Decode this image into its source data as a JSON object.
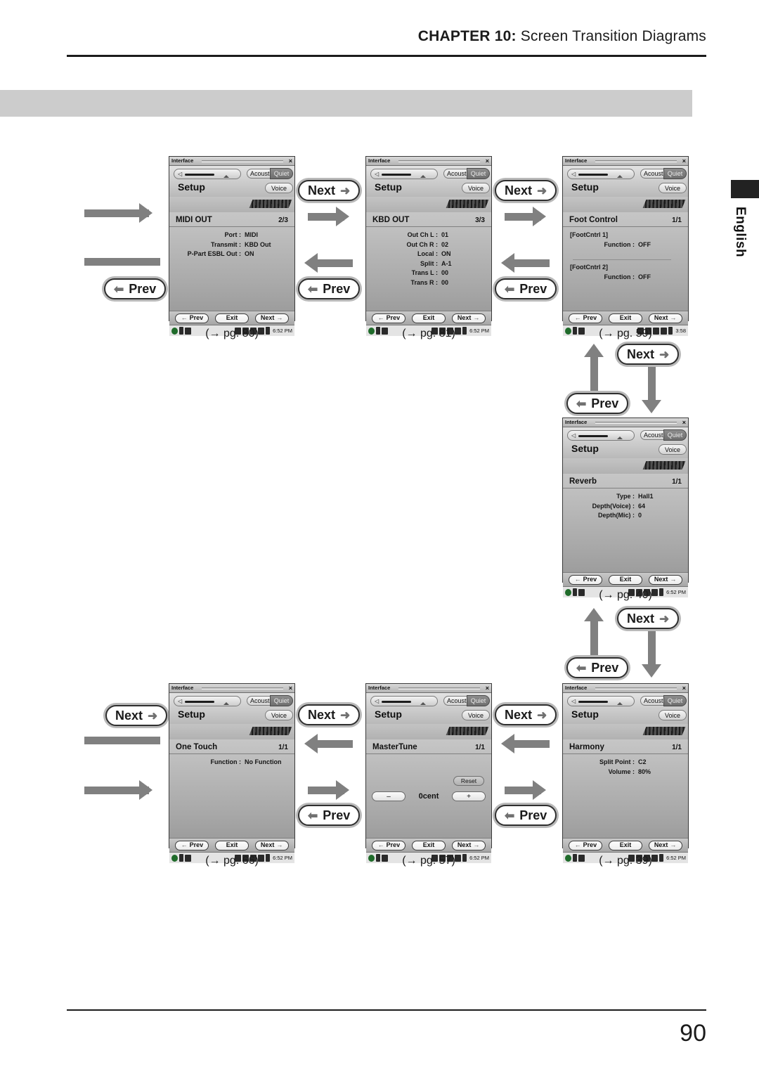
{
  "page": {
    "header_chapter": "CHAPTER 10:",
    "header_title": " Screen Transition Diagrams",
    "number": "90",
    "language_tab": "English"
  },
  "device_common": {
    "window_title": "Interface",
    "close_icon": "×",
    "acoustic_label": "Acoustic",
    "quiet_label": "Quiet",
    "setup_label": "Setup",
    "voice_label": "Voice",
    "nav_prev": "Prev",
    "nav_exit": "Exit",
    "nav_next": "Next",
    "arrow_left": "←",
    "arrow_right": "→"
  },
  "screens": [
    {
      "id": "midi-out",
      "title": "MIDI OUT",
      "pager": "2/3",
      "status_time": "6:52 PM",
      "pgref": "(→ pg. 80)",
      "rows": [
        {
          "k": "Port :",
          "v": "MIDI"
        },
        {
          "k": "Transmit :",
          "v": "KBD Out"
        },
        {
          "k": "P-Part ESBL Out :",
          "v": "ON"
        }
      ]
    },
    {
      "id": "kbd-out",
      "title": "KBD OUT",
      "pager": "3/3",
      "status_time": "6:52 PM",
      "pgref": "(→ pg. 81)",
      "rows": [
        {
          "k": "Out Ch L :",
          "v": "01"
        },
        {
          "k": "Out Ch R :",
          "v": "02"
        },
        {
          "k": "Local :",
          "v": "ON"
        },
        {
          "k": "Split :",
          "v": "A-1"
        },
        {
          "k": "Trans L :",
          "v": "00"
        },
        {
          "k": "Trans R :",
          "v": "00"
        }
      ]
    },
    {
      "id": "foot-control",
      "title": "Foot Control",
      "pager": "1/1",
      "status_time": "3:58",
      "pgref": "(→ pg. 59)",
      "group1": "[FootCntrl 1]",
      "group1_row": {
        "k": "Function :",
        "v": "OFF"
      },
      "group2": "[FootCntrl 2]",
      "group2_row": {
        "k": "Function :",
        "v": "OFF"
      }
    },
    {
      "id": "reverb",
      "title": "Reverb",
      "pager": "1/1",
      "status_time": "6:52 PM",
      "pgref": "(→ pg. 40)",
      "rows": [
        {
          "k": "Type :",
          "v": "Hall1"
        },
        {
          "k": "Depth(Voice) :",
          "v": "64"
        },
        {
          "k": "Depth(Mic) :",
          "v": "0"
        }
      ]
    },
    {
      "id": "one-touch",
      "title": "One Touch",
      "pager": "1/1",
      "status_time": "6:52 PM",
      "pgref": "(→ pg. 66)",
      "rows": [
        {
          "k": "Function :",
          "v": "No Function"
        }
      ]
    },
    {
      "id": "master-tune",
      "title": "MasterTune",
      "pager": "1/1",
      "status_time": "6:52 PM",
      "pgref": "(→ pg. 57)",
      "reset_label": "Reset",
      "minus_label": "–",
      "plus_label": "+",
      "value_label": "0cent"
    },
    {
      "id": "harmony",
      "title": "Harmony",
      "pager": "1/1",
      "status_time": "6:52 PM",
      "pgref": "(→ pg. 39)",
      "rows": [
        {
          "k": "Split Point :",
          "v": "C2"
        },
        {
          "k": "Volume :",
          "v": "80%"
        }
      ]
    }
  ],
  "callouts": {
    "next": "Next",
    "prev": "Prev",
    "next_glyph": "➜",
    "prev_glyph": "⬅"
  },
  "colors": {
    "arrow_gray": "#808080",
    "band_gray": "#cccccc",
    "ink": "#1b1b1b"
  }
}
